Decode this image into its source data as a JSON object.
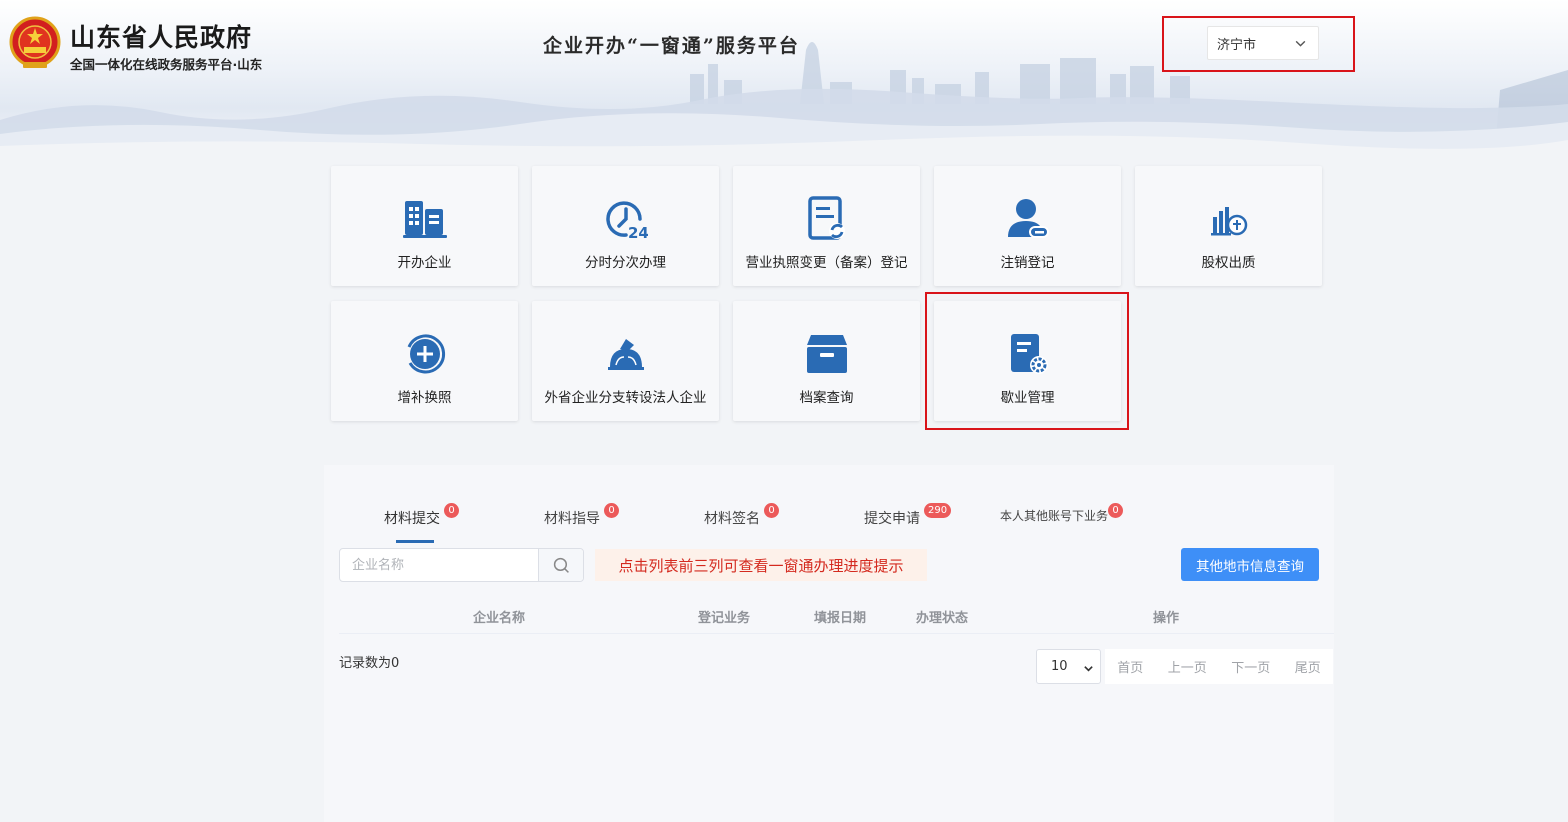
{
  "header": {
    "gov_title": "山东省人民政府",
    "gov_subtitle": "全国一体化在线政务服务平台·山东",
    "platform_title": "企业开办“一窗通”服务平台",
    "city_select": {
      "selected": "济宁市"
    }
  },
  "services": [
    {
      "label": "开办企业",
      "icon": "building-icon"
    },
    {
      "label": "分时分次办理",
      "icon": "clock-24-icon"
    },
    {
      "label": "营业执照变更（备案）登记",
      "icon": "document-refresh-icon"
    },
    {
      "label": "注销登记",
      "icon": "user-minus-icon"
    },
    {
      "label": "股权出质",
      "icon": "equity-chart-icon"
    },
    {
      "label": "增补换照",
      "icon": "plus-circle-icon"
    },
    {
      "label": "外省企业分支转设法人企业",
      "icon": "transfer-icon"
    },
    {
      "label": "档案查询",
      "icon": "archive-box-icon"
    },
    {
      "label": "歇业管理",
      "icon": "document-gear-icon"
    }
  ],
  "tabs": [
    {
      "label": "材料提交",
      "count": "0"
    },
    {
      "label": "材料指导",
      "count": "0"
    },
    {
      "label": "材料签名",
      "count": "0"
    },
    {
      "label": "提交申请",
      "count": "290"
    },
    {
      "label": "本人其他账号下业务",
      "count": "0"
    }
  ],
  "search": {
    "placeholder": "企业名称",
    "value": ""
  },
  "hint": "点击列表前三列可查看一窗通办理进度提示",
  "other_city_button": "其他地市信息查询",
  "table": {
    "columns": [
      "企业名称",
      "登记业务",
      "填报日期",
      "办理状态",
      "操作"
    ],
    "rows": []
  },
  "records_text": "记录数为0",
  "pagination": {
    "page_size": "10",
    "first": "首页",
    "prev": "上一页",
    "next": "下一页",
    "last": "尾页"
  },
  "colors": {
    "accent_blue": "#2a6bb4",
    "button_blue": "#3e8ff7",
    "highlight_red": "#d9141a",
    "badge_red": "#ec5a5a",
    "hint_text": "#d42a1f"
  }
}
